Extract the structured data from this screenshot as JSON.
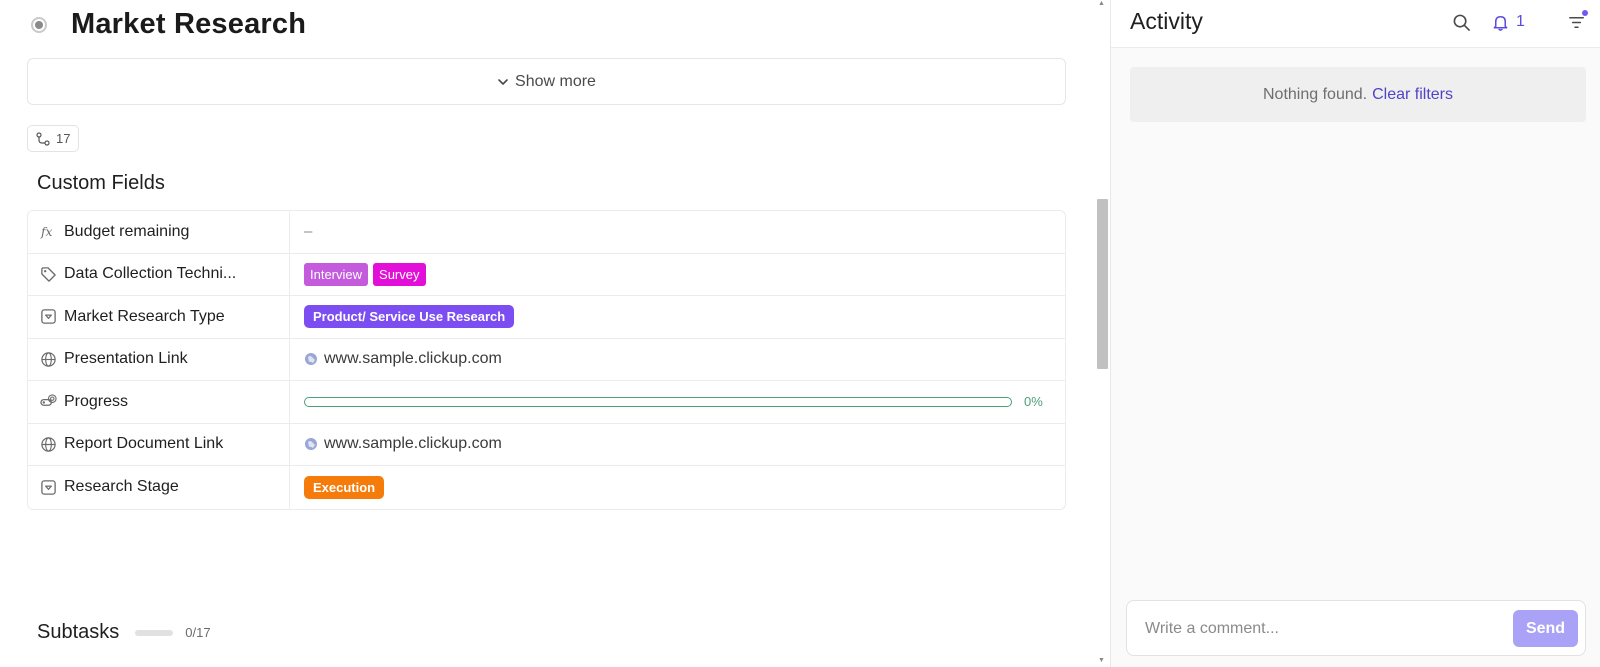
{
  "task": {
    "title": "Market Research",
    "show_more_label": "Show more",
    "relationships_count": "17"
  },
  "custom_fields": {
    "heading": "Custom Fields",
    "rows": [
      {
        "label": "Budget remaining",
        "icon": "formula-icon",
        "value": "–"
      },
      {
        "label": "Data Collection Techni...",
        "icon": "tag-icon",
        "tags": [
          {
            "text": "Interview",
            "color": "#c35bdc"
          },
          {
            "text": "Survey",
            "color": "#e20fd8"
          }
        ]
      },
      {
        "label": "Market Research Type",
        "icon": "dropdown-icon",
        "pill": {
          "text": "Product/ Service Use Research",
          "color": "#7c4df0"
        }
      },
      {
        "label": "Presentation Link",
        "icon": "globe-icon",
        "link": "www.sample.clickup.com"
      },
      {
        "label": "Progress",
        "icon": "progress-icon",
        "progress": {
          "percent": 0,
          "label": "0%",
          "color": "#4e9e7a"
        }
      },
      {
        "label": "Report Document Link",
        "icon": "globe-icon",
        "link": "www.sample.clickup.com"
      },
      {
        "label": "Research Stage",
        "icon": "dropdown-icon",
        "pill": {
          "text": "Execution",
          "color": "#f57c0a"
        }
      }
    ]
  },
  "subtasks": {
    "title": "Subtasks",
    "count": "0/17"
  },
  "activity": {
    "title": "Activity",
    "notifications_count": "1",
    "empty_text": "Nothing found.",
    "clear_filters_label": "Clear filters",
    "comment_placeholder": "Write a comment...",
    "send_label": "Send",
    "accent_color": "#5b4cdb"
  }
}
